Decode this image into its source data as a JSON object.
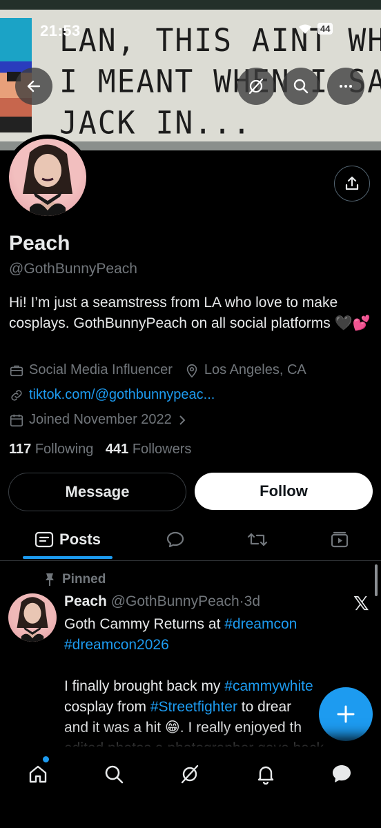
{
  "status_bar": {
    "time": "21:53",
    "battery": "44"
  },
  "banner": {
    "text_lines": [
      "LAN, THIS AINT WH",
      "I MEANT WHEN I SA",
      "JACK IN..."
    ]
  },
  "profile": {
    "name": "Peach",
    "handle": "@GothBunnyPeach",
    "bio": "Hi! I’m just a seamstress from LA who love to make cosplays. GothBunnyPeach on all social platforms 🖤💕",
    "category": "Social Media Influencer",
    "location": "Los Angeles, CA",
    "website": "tiktok.com/@gothbunnypeac...",
    "joined": "Joined November 2022",
    "following_count": "117",
    "following_label": "Following",
    "followers_count": "441",
    "followers_label": "Followers"
  },
  "actions": {
    "message": "Message",
    "follow": "Follow"
  },
  "tabs": {
    "posts": "Posts"
  },
  "pinned_post": {
    "pinned_label": "Pinned",
    "author_name": "Peach",
    "author_handle": "@GothBunnyPeach",
    "dot": "·",
    "age": "3d",
    "line1_text": "Goth Cammy Returns at ",
    "line1_tag": "#dreamcon",
    "line2_tag": "#dreamcon2026",
    "p2_a": "I finally brought back my ",
    "p2_tag1": "#cammywhite",
    "p2_b": " cosplay from ",
    "p2_tag2": "#Streetfighter",
    "p2_c": " to drear",
    "p3_a": "and it was a hit 😁. I really enjoyed th",
    "p4_a": "edited photos a photographer gave back"
  },
  "colors": {
    "accent": "#1d9bf0",
    "muted": "#71767b",
    "background": "#000000"
  }
}
